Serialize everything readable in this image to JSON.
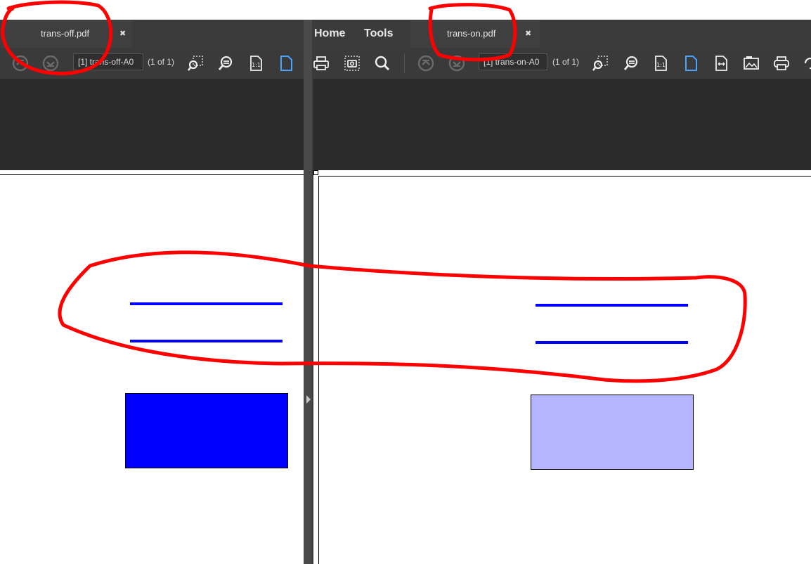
{
  "left_pane": {
    "tab": {
      "label": "trans-off.pdf",
      "close": "✖"
    },
    "page_input": "[1] trans-off-A0",
    "page_count": "(1 of 1)"
  },
  "right_pane": {
    "menu": {
      "home": "Home",
      "tools": "Tools"
    },
    "tab": {
      "label": "trans-on.pdf",
      "close": "✖"
    },
    "page_input": "[1] trans-on-A0",
    "page_count": "(1 of 1)"
  },
  "colors": {
    "line_blue": "#0000ff",
    "rect_opaque": "#0000ff",
    "rect_transparent": "#b4b4ff",
    "annotation_red": "#ff0000"
  },
  "icons": {
    "left": [
      "prev-page-icon",
      "next-page-icon",
      "zoom-marquee-icon",
      "zoom-out-icon",
      "actual-size-icon",
      "fit-page-icon"
    ],
    "right": [
      "print-icon",
      "snapshot-icon",
      "search-icon",
      "prev-page-icon",
      "next-page-icon",
      "zoom-marquee-icon",
      "zoom-out-icon",
      "actual-size-icon",
      "fit-page-icon",
      "fit-width-icon",
      "image-icon",
      "printer-icon"
    ]
  }
}
